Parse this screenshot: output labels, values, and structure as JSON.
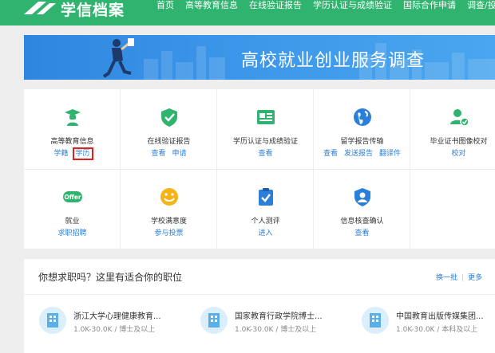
{
  "header": {
    "logo_text": "学信档案",
    "nav": [
      "首页",
      "高等教育信息",
      "在线验证报告",
      "学历认证与成绩验证",
      "国际合作申请",
      "调查/投票"
    ]
  },
  "banner": {
    "title": "高校就业创业服务调查"
  },
  "services": {
    "row1": [
      {
        "name": "高等教育信息",
        "links": [
          "学籍",
          "学历"
        ],
        "icon": "graduate-cap-icon"
      },
      {
        "name": "在线验证报告",
        "links": [
          "查看",
          "申请"
        ],
        "icon": "shield-check-icon"
      },
      {
        "name": "学历认证与成绩验证",
        "links": [
          "查看"
        ],
        "icon": "id-card-icon"
      },
      {
        "name": "留学报告传输",
        "links": [
          "查看",
          "发送报告",
          "翻译件"
        ],
        "icon": "globe-icon"
      },
      {
        "name": "毕业证书图像校对",
        "links": [
          "校对"
        ],
        "icon": "user-check-icon"
      }
    ],
    "row2": [
      {
        "name": "就业",
        "links": [
          "求职招聘"
        ],
        "icon": "offer-badge-icon",
        "badge": "Offer"
      },
      {
        "name": "学校满意度",
        "links": [
          "参与投票"
        ],
        "icon": "smiley-icon"
      },
      {
        "name": "个人测评",
        "links": [
          "进入"
        ],
        "icon": "clipboard-check-icon"
      },
      {
        "name": "信息核查确认",
        "links": [
          "查看"
        ],
        "icon": "person-shield-icon"
      }
    ]
  },
  "jobs": {
    "title": "你想求职吗？这里有适合你的职位",
    "refresh": "换一批",
    "more": "更多",
    "items": [
      {
        "title": "浙江大学心理健康教育...",
        "meta": "1.0K-30.0K / 博士及以上"
      },
      {
        "title": "国家教育行政学院博士...",
        "meta": "1.0K-30.0K / 博士及以上"
      },
      {
        "title": "中国教育出版传媒集团...",
        "meta": "1.0K-30.0K / 本科及以上"
      }
    ]
  },
  "colors": {
    "brand_green": "#2fb36e",
    "link_blue": "#2b7fd8",
    "banner_blue": "#3d98ea",
    "highlight_red": "#e02020"
  }
}
